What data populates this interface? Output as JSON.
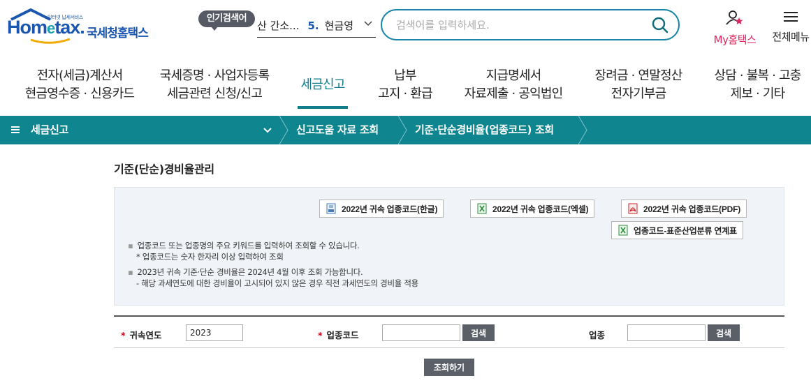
{
  "header": {
    "logo": {
      "tagline": "인터넷 납세서비스",
      "brand_main": "Hom",
      "brand_e": "e",
      "brand_tail": "tax.",
      "korean_name": "국세청홈택스"
    },
    "popular": {
      "badge": "인기검색어",
      "item_prev": "산 간소...",
      "rank": "5.",
      "item_current": "현금영"
    },
    "search": {
      "placeholder": "검색어를 입력하세요."
    },
    "my_hometax": "My홈택스",
    "all_menu": "전체메뉴"
  },
  "nav": [
    {
      "line1": "전자(세금)계산서",
      "line2": "현금영수증 · 신용카드"
    },
    {
      "line1": "국세증명 · 사업자등록",
      "line2": "세금관련 신청/신고"
    },
    {
      "line1": "세금신고",
      "line2": ""
    },
    {
      "line1": "납부",
      "line2": "고지 · 환급"
    },
    {
      "line1": "지급명세서",
      "line2": "자료제출 · 공익법인"
    },
    {
      "line1": "장려금 · 연말정산",
      "line2": "전자기부금"
    },
    {
      "line1": "상담 · 불복 · 고충",
      "line2": "제보 · 기타"
    }
  ],
  "breadcrumb": {
    "section": "세금신고",
    "level2": "신고도움 자료 조회",
    "level3": "기준·단순경비율(업종코드) 조회"
  },
  "page": {
    "title": "기준(단순)경비율관리",
    "downloads": [
      {
        "label": "2022년 귀속 업종코드(한글)",
        "icon": "hwp-file-icon"
      },
      {
        "label": "2022년 귀속 업종코드(엑셀)",
        "icon": "excel-file-icon"
      },
      {
        "label": "2022년 귀속 업종코드(PDF)",
        "icon": "pdf-file-icon"
      },
      {
        "label": "업종코드-표준산업분류 연계표",
        "icon": "excel-file-icon"
      }
    ],
    "notes": [
      "업종코드 또는 업종명의 주요 키워드를 입력하여 조회할 수 있습니다.",
      "* 업종코드는 숫자 한자리 이상 입력하여 조회",
      "2023년 귀속 기준·단순 경비율은 2024년 4월 이후 조회 가능합니다.",
      "- 해당 과세연도에 대한 경비율이 고시되어 있지 않은 경우 직전 과세연도의 경비율 적용"
    ]
  },
  "form": {
    "required_mark": "*",
    "year_label": "귀속연도",
    "year_value": "2023",
    "code_label": "업종코드",
    "code_value": "",
    "code_search": "검색",
    "industry_label": "업종",
    "industry_value": "",
    "industry_search": "검색",
    "submit": "조회하기"
  },
  "colors": {
    "accent": "#0f858f",
    "brand_blue": "#1a56b0",
    "required": "#d0021b",
    "my_pink": "#e0245e"
  }
}
